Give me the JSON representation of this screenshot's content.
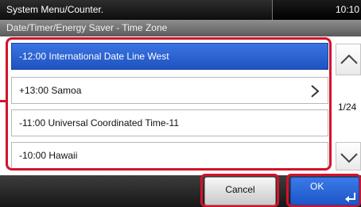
{
  "header": {
    "title": "System Menu/Counter.",
    "clock": "10:10"
  },
  "subheader": {
    "breadcrumb": "Date/Timer/Energy Saver - Time Zone"
  },
  "timezone_list": {
    "items": [
      {
        "label": "-12:00 International Date Line West",
        "selected": true
      },
      {
        "label": "+13:00 Samoa",
        "selected": false,
        "has_submenu": true
      },
      {
        "label": "-11:00 Universal Coordinated Time-11",
        "selected": false
      },
      {
        "label": "-10:00 Hawaii",
        "selected": false
      }
    ]
  },
  "pagination": {
    "page_indicator": "1/24"
  },
  "footer": {
    "cancel_label": "Cancel",
    "ok_label": "OK"
  },
  "colors": {
    "highlight_frame": "#d4122b",
    "selected_item": "#2a63d6",
    "ok_button": "#2a63d6"
  },
  "icons": {
    "scroll_up": "chevron-up-icon",
    "scroll_down": "chevron-down-icon",
    "submenu": "chevron-right-icon",
    "enter": "enter-return-icon"
  }
}
